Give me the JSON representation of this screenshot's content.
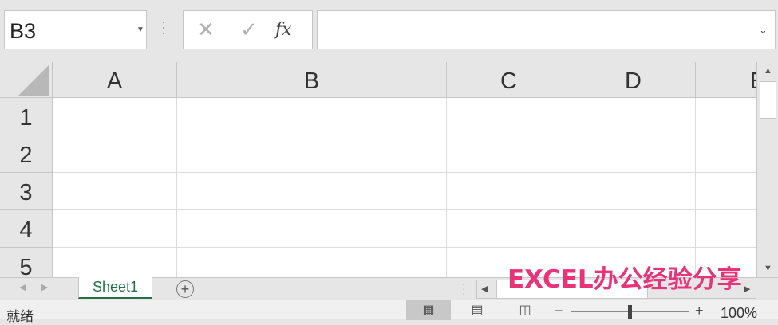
{
  "formula_bar": {
    "name_box": "B3",
    "fx_label": "fx",
    "formula_value": ""
  },
  "columns": [
    "A",
    "B",
    "C",
    "D",
    "E"
  ],
  "rows": [
    "1",
    "2",
    "3",
    "4",
    "5"
  ],
  "sheet_tabs": [
    {
      "label": "Sheet1",
      "active": true
    }
  ],
  "add_sheet_label": "+",
  "watermark": "EXCEL办公经验分享",
  "status_bar": {
    "status": "就绪",
    "zoom_minus": "−",
    "zoom_plus": "+",
    "zoom_level": "100%"
  },
  "colors": {
    "accent": "#217346",
    "watermark": "#e8337a"
  },
  "icons": {
    "cancel": "cancel-icon",
    "enter": "enter-icon",
    "fx": "function-icon",
    "normal_view": "normal-view-icon",
    "page_layout_view": "page-layout-view-icon",
    "page_break_view": "page-break-view-icon"
  }
}
